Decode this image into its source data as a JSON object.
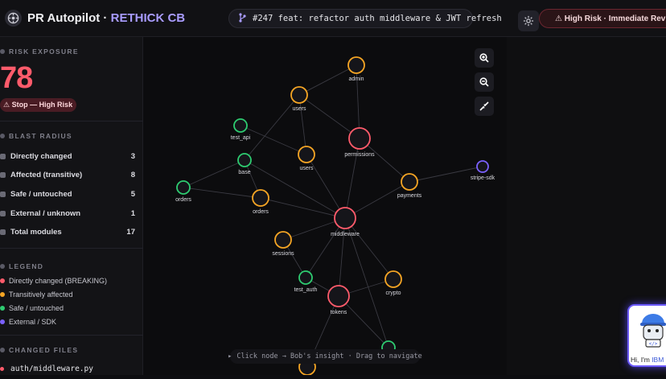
{
  "header": {
    "app_title": "PR Autopilot",
    "separator": " · ",
    "repo": "RETHICK CB",
    "pr_text": "#247 feat: refactor auth middleware & JWT refresh",
    "risk_badge": "High Risk · Immediate Review"
  },
  "sidebar": {
    "risk_title": "RISK EXPOSURE",
    "risk_score": "78",
    "risk_verdict": "⚠ Stop — High Risk",
    "blast_title": "BLAST RADIUS",
    "stats": [
      {
        "label": "Directly changed",
        "value": "3"
      },
      {
        "label": "Affected (transitive)",
        "value": "8"
      },
      {
        "label": "Safe / untouched",
        "value": "5"
      },
      {
        "label": "External / unknown",
        "value": "1"
      },
      {
        "label": "Total modules",
        "value": "17"
      }
    ],
    "legend_title": "LEGEND",
    "legend": [
      {
        "label": "Directly changed (BREAKING)",
        "color": "#ff5b6b"
      },
      {
        "label": "Transitively affected",
        "color": "#f5a524"
      },
      {
        "label": "Safe / untouched",
        "color": "#2ecc71"
      },
      {
        "label": "External / SDK",
        "color": "#7b61ff"
      }
    ],
    "files_title": "CHANGED FILES",
    "files": [
      "auth/middleware.py"
    ]
  },
  "graph": {
    "hint": "Click node → Bob's insight · Drag to navigate",
    "colors": {
      "changed": "#ff5b6b",
      "affected": "#f5a524",
      "safe": "#2ecc71",
      "external": "#7b61ff"
    },
    "nodes": [
      {
        "id": "admin",
        "label": "admin",
        "status": "affected"
      },
      {
        "id": "users_top",
        "label": "users",
        "status": "affected"
      },
      {
        "id": "test_api",
        "label": "test_api",
        "status": "safe"
      },
      {
        "id": "permissions",
        "label": "permissions",
        "status": "changed"
      },
      {
        "id": "base",
        "label": "base",
        "status": "safe"
      },
      {
        "id": "users_mid",
        "label": "users",
        "status": "affected"
      },
      {
        "id": "stripe",
        "label": "stripe-sdk",
        "status": "external"
      },
      {
        "id": "payments",
        "label": "payments",
        "status": "affected"
      },
      {
        "id": "orders_left",
        "label": "orders",
        "status": "safe"
      },
      {
        "id": "orders_mid",
        "label": "orders",
        "status": "affected"
      },
      {
        "id": "middleware",
        "label": "middleware",
        "status": "changed"
      },
      {
        "id": "sessions",
        "label": "sessions",
        "status": "affected"
      },
      {
        "id": "test_auth",
        "label": "test_auth",
        "status": "safe"
      },
      {
        "id": "tokens",
        "label": "tokens",
        "status": "changed"
      },
      {
        "id": "crypto",
        "label": "crypto",
        "status": "affected"
      },
      {
        "id": "bottom_safe",
        "label": "",
        "status": "safe"
      },
      {
        "id": "bottom_aff",
        "label": "",
        "status": "affected"
      }
    ]
  },
  "bob": {
    "greeting": "Hi, I'm ",
    "brand": "IBM"
  }
}
